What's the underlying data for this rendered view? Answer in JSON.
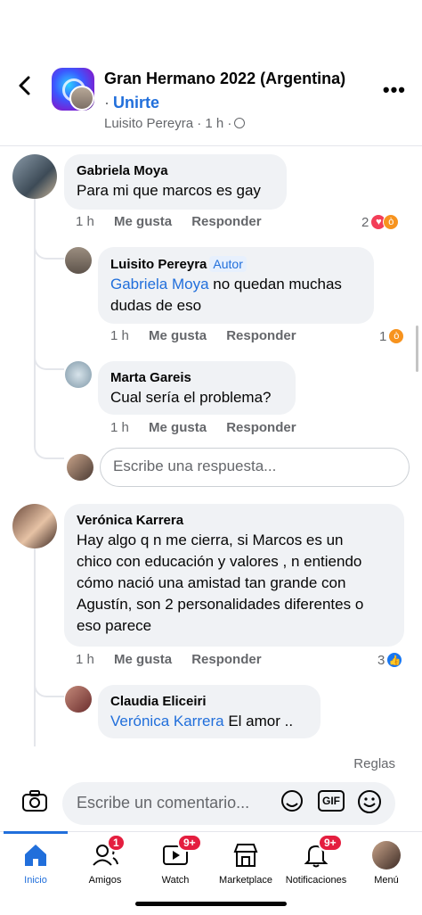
{
  "header": {
    "title": "Gran Hermano 2022 (Argentina)",
    "separator": "·",
    "join_label": "Unirte",
    "meta": "Luisito Pereyra · 1 h ·",
    "back_icon": "back-arrow-icon",
    "more_icon": "more-options-icon"
  },
  "comments": [
    {
      "author": "Gabriela Moya",
      "text": "Para mi que marcos es gay",
      "time": "1 h",
      "like": "Me gusta",
      "reply": "Responder",
      "reaction_count": "2",
      "reactions": [
        "love",
        "angry"
      ],
      "replies": [
        {
          "author": "Luisito Pereyra",
          "badge": "Autor",
          "mention": "Gabriela Moya",
          "text": "no quedan muchas dudas de eso",
          "time": "1 h",
          "like": "Me gusta",
          "reply": "Responder",
          "reaction_count": "1",
          "reactions": [
            "angry"
          ]
        },
        {
          "author": "Marta Gareis",
          "text": "Cual sería el problema?",
          "time": "1 h",
          "like": "Me gusta",
          "reply": "Responder"
        }
      ],
      "reply_placeholder": "Escribe una respuesta..."
    },
    {
      "author": "Verónica Karrera",
      "text_lines": [
        "Hay algo q n me cierra, si Marcos es un",
        "chico con educación y valores , n entiendo",
        "cómo nació una amistad tan grande con",
        "Agustín, son 2 personalidades diferentes o",
        "eso parece"
      ],
      "time": "1 h",
      "like": "Me gusta",
      "reply": "Responder",
      "reaction_count": "3",
      "reactions": [
        "like"
      ],
      "replies": [
        {
          "author": "Claudia Eliceiri",
          "mention": "Verónica Karrera",
          "text": "El amor .."
        }
      ]
    }
  ],
  "composer": {
    "reglas": "Reglas",
    "placeholder": "Escribe un comentario...",
    "gif_label": "GIF"
  },
  "tabbar": [
    {
      "label": "Inicio",
      "icon": "home-icon",
      "active": true
    },
    {
      "label": "Amigos",
      "icon": "friends-icon",
      "badge": "1"
    },
    {
      "label": "Watch",
      "icon": "watch-icon",
      "badge": "9+"
    },
    {
      "label": "Marketplace",
      "icon": "marketplace-icon"
    },
    {
      "label": "Notificaciones",
      "icon": "bell-icon",
      "badge": "9+"
    },
    {
      "label": "Menú",
      "icon": "menu-avatar-icon"
    }
  ],
  "colors": {
    "accent": "#216fdb",
    "bubble": "#f0f2f5",
    "badge": "#e41e3f"
  }
}
